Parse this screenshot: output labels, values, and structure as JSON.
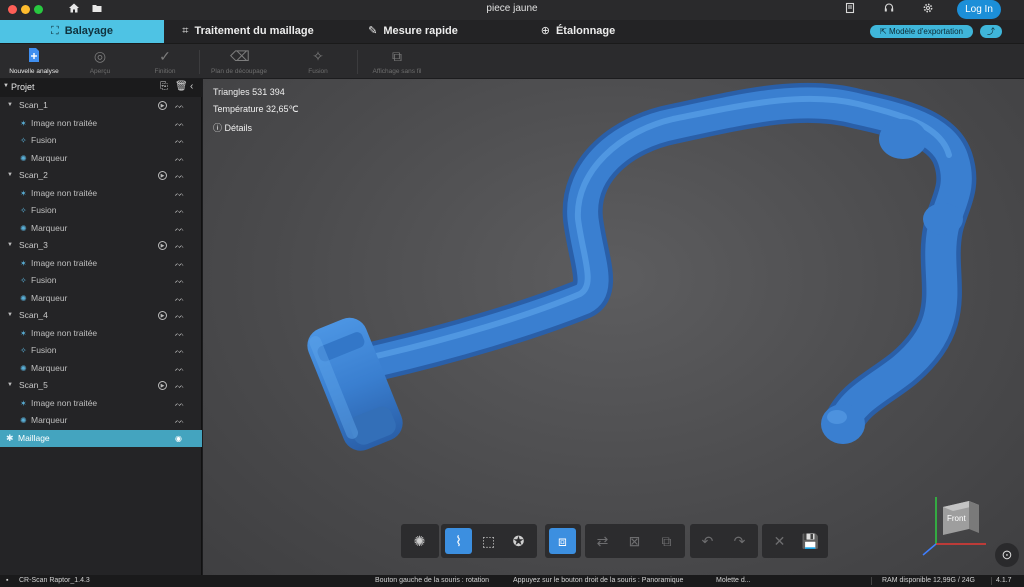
{
  "window": {
    "title": "piece jaune",
    "login_label": "Log In"
  },
  "tabs": [
    {
      "label": "Balayage",
      "icon": "scan-frame-icon",
      "active": true
    },
    {
      "label": "Traitement du maillage",
      "icon": "mesh-processing-icon",
      "active": false
    },
    {
      "label": "Mesure rapide",
      "icon": "ruler-icon",
      "active": false
    },
    {
      "label": "Étalonnage",
      "icon": "target-icon",
      "active": false
    }
  ],
  "header_actions": {
    "export_model_label": "Modèle d'exportation",
    "share_icon": "share-icon"
  },
  "toolbar": {
    "items": [
      {
        "label": "Nouvelle analyse",
        "icon": "new-scan-icon",
        "active": true
      },
      {
        "label": "Aperçu",
        "icon": "preview-icon",
        "active": false
      },
      {
        "label": "Finition",
        "icon": "check-icon",
        "active": false
      },
      {
        "label": "Plan de découpage",
        "icon": "eraser-icon",
        "active": false
      },
      {
        "label": "Fusion",
        "icon": "magic-wand-icon",
        "active": false
      },
      {
        "label": "Affichage sans fil",
        "icon": "wireless-display-icon",
        "active": false
      }
    ]
  },
  "sidebar": {
    "title": "Projet",
    "scans": [
      {
        "name": "Scan_1",
        "children": [
          "Image non traitée",
          "Fusion",
          "Marqueur"
        ]
      },
      {
        "name": "Scan_2",
        "children": [
          "Image non traitée",
          "Fusion",
          "Marqueur"
        ]
      },
      {
        "name": "Scan_3",
        "children": [
          "Image non traitée",
          "Fusion",
          "Marqueur"
        ]
      },
      {
        "name": "Scan_4",
        "children": [
          "Image non traitée",
          "Fusion",
          "Marqueur"
        ]
      },
      {
        "name": "Scan_5",
        "children": [
          "Image non traitée",
          "Marqueur"
        ]
      }
    ],
    "mesh_label": "Maillage"
  },
  "viewport": {
    "triangles": "Triangles 531 394",
    "temperature": "Température 32,65℃",
    "details": "Détails",
    "orientation_face": "Front",
    "model_color": "#3a7fd0"
  },
  "bottom_tools": [
    {
      "icon": "lighting-icon",
      "state": "normal"
    },
    {
      "icon": "lasso-select-icon",
      "state": "on"
    },
    {
      "icon": "rect-select-icon",
      "state": "normal"
    },
    {
      "icon": "brush-select-icon",
      "state": "normal"
    },
    {
      "icon": "select-all-icon",
      "state": "on"
    },
    {
      "icon": "invert-selection-icon",
      "state": "dim"
    },
    {
      "icon": "deselect-icon",
      "state": "dim"
    },
    {
      "icon": "connected-select-icon",
      "state": "dim"
    },
    {
      "icon": "undo-icon",
      "state": "dim"
    },
    {
      "icon": "redo-icon",
      "state": "dim"
    },
    {
      "icon": "delete-icon",
      "state": "dim"
    },
    {
      "icon": "save-icon",
      "state": "dim"
    }
  ],
  "status": {
    "app": "CR-Scan Raptor_1.4.3",
    "hint_left": "Bouton gauche de la souris : rotation",
    "hint_right": "Appuyez sur le bouton droit de la souris : Panoramique",
    "hint_wheel": "Molette d...",
    "ram": "RAM disponible 12,99G / 24G",
    "version": "4.1.7"
  },
  "colors": {
    "accent": "#4ec3e4",
    "login": "#1c8fd8",
    "selected_row": "#44a4bf"
  }
}
